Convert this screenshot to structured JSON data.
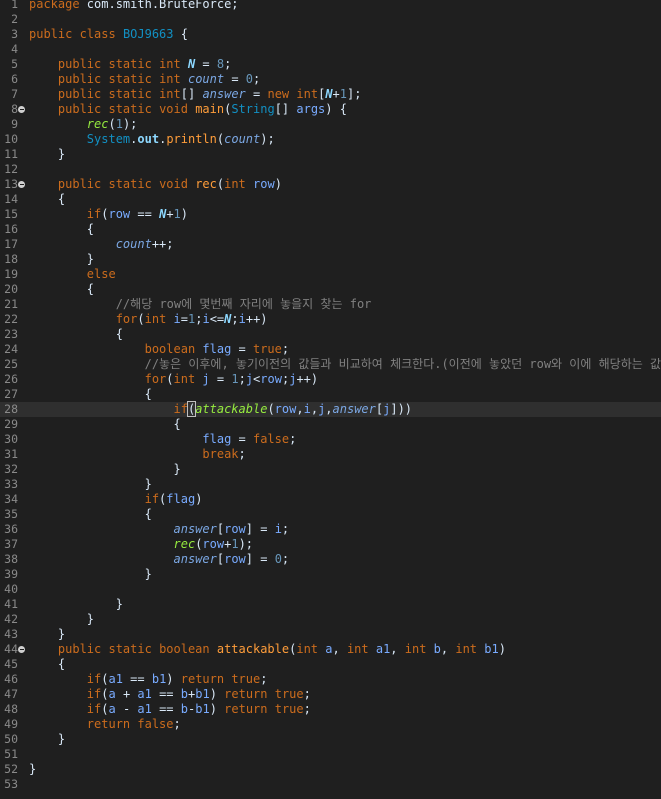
{
  "editor": {
    "lines": [
      [
        {
          "t": "package ",
          "c": "kw"
        },
        {
          "t": "com.smith.BruteForce;"
        }
      ],
      [],
      [
        {
          "t": "public ",
          "c": "kw"
        },
        {
          "t": "class ",
          "c": "kw"
        },
        {
          "t": "BOJ9663",
          "c": "cls"
        },
        {
          "t": " {"
        }
      ],
      [],
      [
        {
          "t": "    "
        },
        {
          "t": "public ",
          "c": "kw"
        },
        {
          "t": "static ",
          "c": "kw"
        },
        {
          "t": "int ",
          "c": "kw"
        },
        {
          "t": "N",
          "c": "sfld"
        },
        {
          "t": " = "
        },
        {
          "t": "8",
          "c": "num"
        },
        {
          "t": ";"
        }
      ],
      [
        {
          "t": "    "
        },
        {
          "t": "public ",
          "c": "kw"
        },
        {
          "t": "static ",
          "c": "kw"
        },
        {
          "t": "int ",
          "c": "kw"
        },
        {
          "t": "count",
          "c": "fld"
        },
        {
          "t": " = "
        },
        {
          "t": "0",
          "c": "num"
        },
        {
          "t": ";"
        }
      ],
      [
        {
          "t": "    "
        },
        {
          "t": "public ",
          "c": "kw"
        },
        {
          "t": "static ",
          "c": "kw"
        },
        {
          "t": "int",
          "c": "kw"
        },
        {
          "t": "[] "
        },
        {
          "t": "answer",
          "c": "fld"
        },
        {
          "t": " = "
        },
        {
          "t": "new ",
          "c": "kw"
        },
        {
          "t": "int",
          "c": "kw"
        },
        {
          "t": "["
        },
        {
          "t": "N",
          "c": "sfld"
        },
        {
          "t": "+"
        },
        {
          "t": "1",
          "c": "num"
        },
        {
          "t": "];"
        }
      ],
      [
        {
          "t": "    "
        },
        {
          "t": "public ",
          "c": "kw"
        },
        {
          "t": "static ",
          "c": "kw"
        },
        {
          "t": "void ",
          "c": "kw"
        },
        {
          "t": "main",
          "c": "mth"
        },
        {
          "t": "("
        },
        {
          "t": "String",
          "c": "cls"
        },
        {
          "t": "[] "
        },
        {
          "t": "args",
          "c": "var"
        },
        {
          "t": ") {"
        }
      ],
      [
        {
          "t": "        "
        },
        {
          "t": "rec",
          "c": "smth"
        },
        {
          "t": "("
        },
        {
          "t": "1",
          "c": "num"
        },
        {
          "t": ");"
        }
      ],
      [
        {
          "t": "        "
        },
        {
          "t": "System",
          "c": "cls"
        },
        {
          "t": "."
        },
        {
          "t": "out",
          "c": "st"
        },
        {
          "t": "."
        },
        {
          "t": "println",
          "c": "mth"
        },
        {
          "t": "("
        },
        {
          "t": "count",
          "c": "fld"
        },
        {
          "t": ");"
        }
      ],
      [
        {
          "t": "    }"
        }
      ],
      [],
      [
        {
          "t": "    "
        },
        {
          "t": "public ",
          "c": "kw"
        },
        {
          "t": "static ",
          "c": "kw"
        },
        {
          "t": "void ",
          "c": "kw"
        },
        {
          "t": "rec",
          "c": "mth"
        },
        {
          "t": "("
        },
        {
          "t": "int ",
          "c": "kw"
        },
        {
          "t": "row",
          "c": "var"
        },
        {
          "t": ")"
        }
      ],
      [
        {
          "t": "    {"
        }
      ],
      [
        {
          "t": "        "
        },
        {
          "t": "if",
          "c": "kw"
        },
        {
          "t": "("
        },
        {
          "t": "row",
          "c": "var"
        },
        {
          "t": " == "
        },
        {
          "t": "N",
          "c": "sfld"
        },
        {
          "t": "+"
        },
        {
          "t": "1",
          "c": "num"
        },
        {
          "t": ")"
        }
      ],
      [
        {
          "t": "        {"
        }
      ],
      [
        {
          "t": "            "
        },
        {
          "t": "count",
          "c": "fld"
        },
        {
          "t": "++;"
        }
      ],
      [
        {
          "t": "        }"
        }
      ],
      [
        {
          "t": "        "
        },
        {
          "t": "else",
          "c": "kw"
        }
      ],
      [
        {
          "t": "        {"
        }
      ],
      [
        {
          "t": "            "
        },
        {
          "t": "//해당 row에 몇번째 자리에 놓을지 찾는 for",
          "c": "cmt"
        }
      ],
      [
        {
          "t": "            "
        },
        {
          "t": "for",
          "c": "kw"
        },
        {
          "t": "("
        },
        {
          "t": "int ",
          "c": "kw"
        },
        {
          "t": "i",
          "c": "var"
        },
        {
          "t": "="
        },
        {
          "t": "1",
          "c": "num"
        },
        {
          "t": ";"
        },
        {
          "t": "i",
          "c": "var"
        },
        {
          "t": "<="
        },
        {
          "t": "N",
          "c": "sfld"
        },
        {
          "t": ";"
        },
        {
          "t": "i",
          "c": "var"
        },
        {
          "t": "++)"
        }
      ],
      [
        {
          "t": "            {"
        }
      ],
      [
        {
          "t": "                "
        },
        {
          "t": "boolean ",
          "c": "kw"
        },
        {
          "t": "flag",
          "c": "var"
        },
        {
          "t": " = "
        },
        {
          "t": "true",
          "c": "kw"
        },
        {
          "t": ";"
        }
      ],
      [
        {
          "t": "                "
        },
        {
          "t": "//놓은 이후에, 놓기이전의 값들과 비교하여 체크한다.(이전에 놓았던 row와 이에 해당하는 값)",
          "c": "cmt"
        }
      ],
      [
        {
          "t": "                "
        },
        {
          "t": "for",
          "c": "kw"
        },
        {
          "t": "("
        },
        {
          "t": "int ",
          "c": "kw"
        },
        {
          "t": "j",
          "c": "var"
        },
        {
          "t": " = "
        },
        {
          "t": "1",
          "c": "num"
        },
        {
          "t": ";"
        },
        {
          "t": "j",
          "c": "var"
        },
        {
          "t": "<"
        },
        {
          "t": "row",
          "c": "var"
        },
        {
          "t": ";"
        },
        {
          "t": "j",
          "c": "var"
        },
        {
          "t": "++)"
        }
      ],
      [
        {
          "t": "                {"
        }
      ],
      [
        {
          "t": "                    "
        },
        {
          "t": "if",
          "c": "kw"
        },
        {
          "t": "(",
          "c": "bracket-box"
        },
        {
          "t": "attackable",
          "c": "smth"
        },
        {
          "t": "("
        },
        {
          "t": "row",
          "c": "var"
        },
        {
          "t": ","
        },
        {
          "t": "i",
          "c": "var"
        },
        {
          "t": ","
        },
        {
          "t": "j",
          "c": "var"
        },
        {
          "t": ","
        },
        {
          "t": "answer",
          "c": "fld"
        },
        {
          "t": "["
        },
        {
          "t": "j",
          "c": "var"
        },
        {
          "t": "]))"
        }
      ],
      [
        {
          "t": "                    {"
        }
      ],
      [
        {
          "t": "                        "
        },
        {
          "t": "flag",
          "c": "var"
        },
        {
          "t": " = "
        },
        {
          "t": "false",
          "c": "kw"
        },
        {
          "t": ";"
        }
      ],
      [
        {
          "t": "                        "
        },
        {
          "t": "break",
          "c": "kw"
        },
        {
          "t": ";"
        }
      ],
      [
        {
          "t": "                    }"
        }
      ],
      [
        {
          "t": "                }"
        }
      ],
      [
        {
          "t": "                "
        },
        {
          "t": "if",
          "c": "kw"
        },
        {
          "t": "("
        },
        {
          "t": "flag",
          "c": "var"
        },
        {
          "t": ")"
        }
      ],
      [
        {
          "t": "                {"
        }
      ],
      [
        {
          "t": "                    "
        },
        {
          "t": "answer",
          "c": "fld"
        },
        {
          "t": "["
        },
        {
          "t": "row",
          "c": "var"
        },
        {
          "t": "] = "
        },
        {
          "t": "i",
          "c": "var"
        },
        {
          "t": ";"
        }
      ],
      [
        {
          "t": "                    "
        },
        {
          "t": "rec",
          "c": "smth"
        },
        {
          "t": "("
        },
        {
          "t": "row",
          "c": "var"
        },
        {
          "t": "+"
        },
        {
          "t": "1",
          "c": "num"
        },
        {
          "t": ");"
        }
      ],
      [
        {
          "t": "                    "
        },
        {
          "t": "answer",
          "c": "fld"
        },
        {
          "t": "["
        },
        {
          "t": "row",
          "c": "var"
        },
        {
          "t": "] = "
        },
        {
          "t": "0",
          "c": "num"
        },
        {
          "t": ";"
        }
      ],
      [
        {
          "t": "                }"
        }
      ],
      [],
      [
        {
          "t": "            }"
        }
      ],
      [
        {
          "t": "        }"
        }
      ],
      [
        {
          "t": "    }"
        }
      ],
      [
        {
          "t": "    "
        },
        {
          "t": "public ",
          "c": "kw"
        },
        {
          "t": "static ",
          "c": "kw"
        },
        {
          "t": "boolean ",
          "c": "kw"
        },
        {
          "t": "attackable",
          "c": "mth"
        },
        {
          "t": "("
        },
        {
          "t": "int ",
          "c": "kw"
        },
        {
          "t": "a",
          "c": "var"
        },
        {
          "t": ", "
        },
        {
          "t": "int ",
          "c": "kw"
        },
        {
          "t": "a1",
          "c": "var"
        },
        {
          "t": ", "
        },
        {
          "t": "int ",
          "c": "kw"
        },
        {
          "t": "b",
          "c": "var"
        },
        {
          "t": ", "
        },
        {
          "t": "int ",
          "c": "kw"
        },
        {
          "t": "b1",
          "c": "var"
        },
        {
          "t": ")"
        }
      ],
      [
        {
          "t": "    {"
        }
      ],
      [
        {
          "t": "        "
        },
        {
          "t": "if",
          "c": "kw"
        },
        {
          "t": "("
        },
        {
          "t": "a1",
          "c": "var"
        },
        {
          "t": " == "
        },
        {
          "t": "b1",
          "c": "var"
        },
        {
          "t": ") "
        },
        {
          "t": "return ",
          "c": "kw"
        },
        {
          "t": "true",
          "c": "kw"
        },
        {
          "t": ";"
        }
      ],
      [
        {
          "t": "        "
        },
        {
          "t": "if",
          "c": "kw"
        },
        {
          "t": "("
        },
        {
          "t": "a",
          "c": "var"
        },
        {
          "t": " + "
        },
        {
          "t": "a1",
          "c": "var"
        },
        {
          "t": " == "
        },
        {
          "t": "b",
          "c": "var"
        },
        {
          "t": "+"
        },
        {
          "t": "b1",
          "c": "var"
        },
        {
          "t": ") "
        },
        {
          "t": "return ",
          "c": "kw"
        },
        {
          "t": "true",
          "c": "kw"
        },
        {
          "t": ";"
        }
      ],
      [
        {
          "t": "        "
        },
        {
          "t": "if",
          "c": "kw"
        },
        {
          "t": "("
        },
        {
          "t": "a",
          "c": "var"
        },
        {
          "t": " - "
        },
        {
          "t": "a1",
          "c": "var"
        },
        {
          "t": " == "
        },
        {
          "t": "b",
          "c": "var"
        },
        {
          "t": "-"
        },
        {
          "t": "b1",
          "c": "var"
        },
        {
          "t": ") "
        },
        {
          "t": "return ",
          "c": "kw"
        },
        {
          "t": "true",
          "c": "kw"
        },
        {
          "t": ";"
        }
      ],
      [
        {
          "t": "        "
        },
        {
          "t": "return ",
          "c": "kw"
        },
        {
          "t": "false",
          "c": "kw"
        },
        {
          "t": ";"
        }
      ],
      [
        {
          "t": "    }"
        }
      ],
      [],
      [
        {
          "t": "}"
        }
      ],
      []
    ],
    "line_numbers": [
      "1",
      "2",
      "3",
      "4",
      "5",
      "6",
      "7",
      "8",
      "9",
      "10",
      "11",
      "12",
      "13",
      "14",
      "15",
      "16",
      "17",
      "18",
      "19",
      "20",
      "21",
      "22",
      "23",
      "24",
      "25",
      "26",
      "27",
      "28",
      "29",
      "30",
      "31",
      "32",
      "33",
      "34",
      "35",
      "36",
      "37",
      "38",
      "39",
      "40",
      "41",
      "42",
      "43",
      "44",
      "45",
      "46",
      "47",
      "48",
      "49",
      "50",
      "51",
      "52",
      "53"
    ],
    "fold_markers_at_lines": [
      8,
      13,
      44
    ],
    "current_line": 28
  },
  "colors": {
    "background": "#1f1f1f",
    "current_line": "#2f2f2f",
    "keyword": "#cc6c1d",
    "comment": "#808080"
  }
}
